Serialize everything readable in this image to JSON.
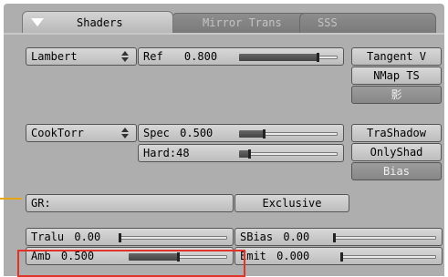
{
  "tabs": {
    "active": "Shaders",
    "mirror": "Mirror Trans",
    "sss": "SSS"
  },
  "diffuse": {
    "shader_menu": "Lambert",
    "ref_label": "Ref",
    "ref_value": "0.800",
    "ref_level": 0.8
  },
  "specular": {
    "shader_menu": "CookTorr",
    "spec_label": "Spec",
    "spec_value": "0.500",
    "spec_level": 0.25,
    "hard_label": "Hard:",
    "hard_value": "48",
    "hard_level": 0.1
  },
  "toggles": {
    "tangent": "Tangent V",
    "nmap": "NMap TS",
    "shadow_icon": "影",
    "trashadow": "TraShadow",
    "onlyshad": "OnlyShad",
    "bias": "Bias"
  },
  "group": {
    "gr_label": "GR:",
    "exclusive": "Exclusive"
  },
  "bottom": {
    "tralu_label": "Tralu",
    "tralu_value": "0.00",
    "tralu_level": 0.0,
    "sbias_label": "SBias",
    "sbias_value": "0.00",
    "sbias_level": 0.0,
    "amb_label": "Amb",
    "amb_value": "0.500",
    "amb_level": 0.5,
    "emit_label": "Emit",
    "emit_value": "0.000",
    "emit_level": 0.0
  },
  "colors": {
    "panel": "#aeaeae",
    "highlight_box": "#e0342b",
    "orange_marker": "#e8a415"
  }
}
